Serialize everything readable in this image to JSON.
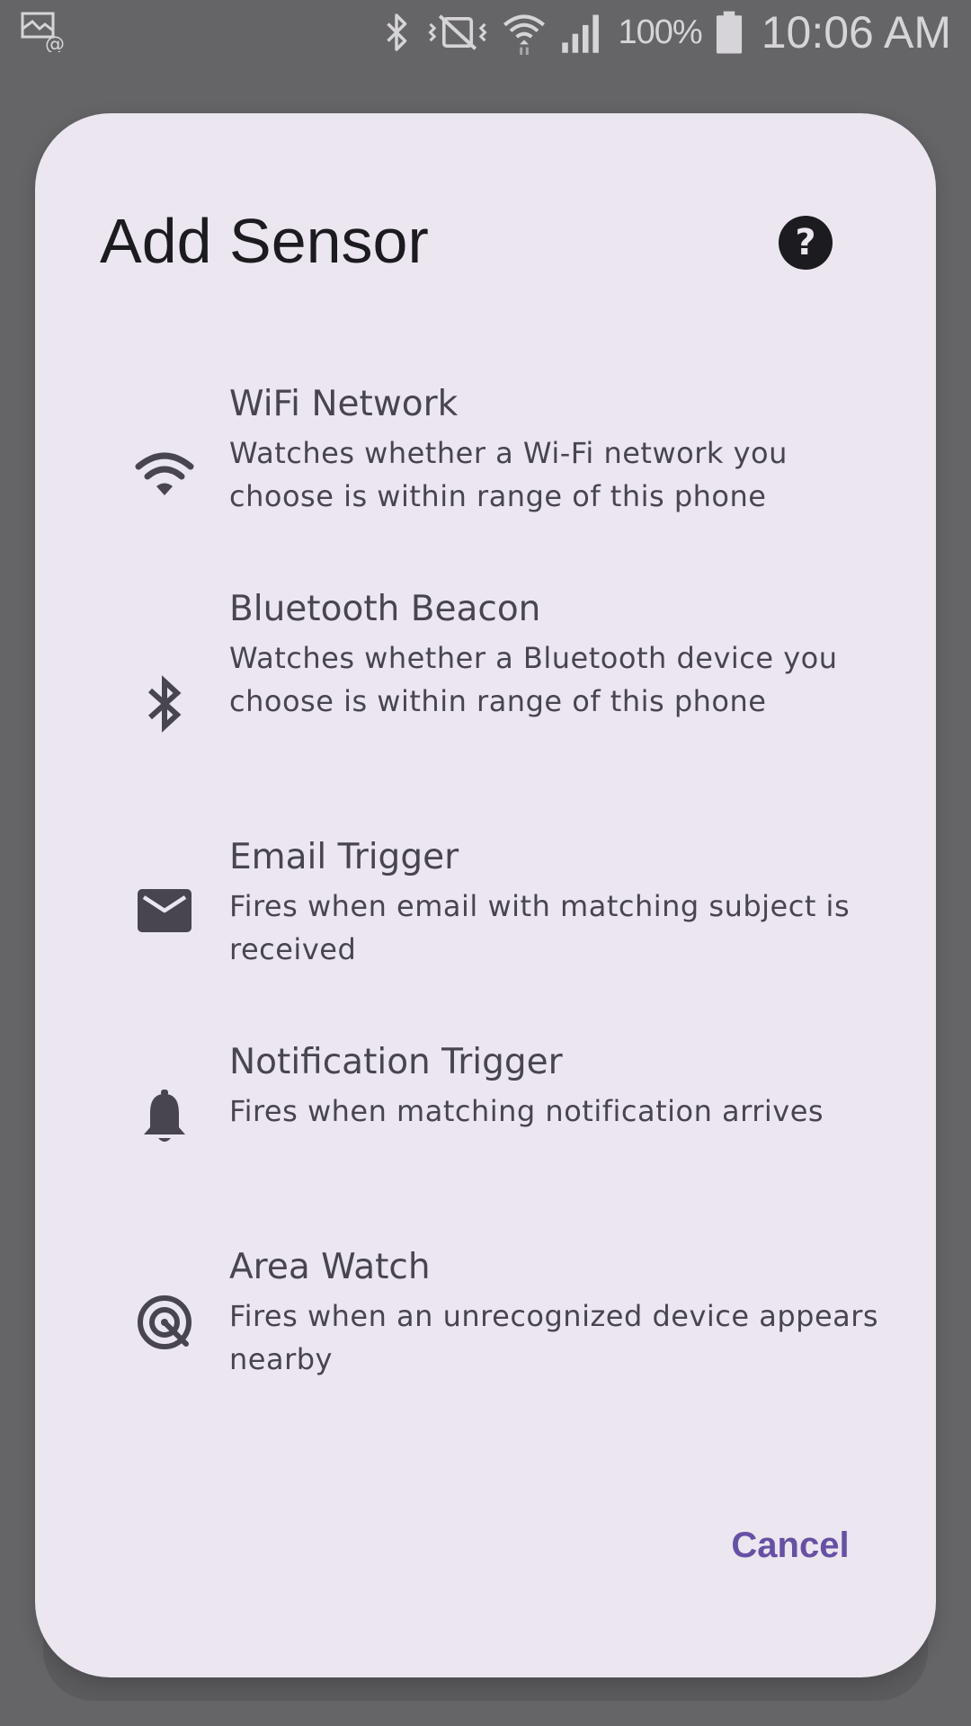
{
  "status_bar": {
    "battery_percent": "100%",
    "time": "10:06 AM",
    "icons": [
      "screen-mirroring-icon",
      "bluetooth-icon",
      "vibrate-mute-icon",
      "wifi-icon",
      "cellular-signal-icon",
      "battery-icon"
    ]
  },
  "dialog": {
    "title": "Add Sensor",
    "help_icon": "help-icon",
    "items": [
      {
        "icon": "wifi-icon",
        "title": "WiFi Network",
        "description": "Watches whether a Wi-Fi network you choose is within range of this phone"
      },
      {
        "icon": "bluetooth-icon",
        "title": "Bluetooth Beacon",
        "description": "Watches whether a Bluetooth device you choose is within range of this phone"
      },
      {
        "icon": "email-icon",
        "title": "Email Trigger",
        "description": "Fires when email with matching subject is received"
      },
      {
        "icon": "bell-icon",
        "title": "Notification Trigger",
        "description": "Fires when matching notification arrives"
      },
      {
        "icon": "radar-target-icon",
        "title": "Area Watch",
        "description": "Fires when an unrecognized device appears nearby"
      }
    ],
    "cancel_label": "Cancel"
  },
  "colors": {
    "scrim": "#656467",
    "dialog_surface": "#ebe6f0",
    "on_surface": "#1c1b1f",
    "on_surface_variant": "#49454f",
    "primary": "#6750a4",
    "status_text": "#d6d4d8"
  }
}
